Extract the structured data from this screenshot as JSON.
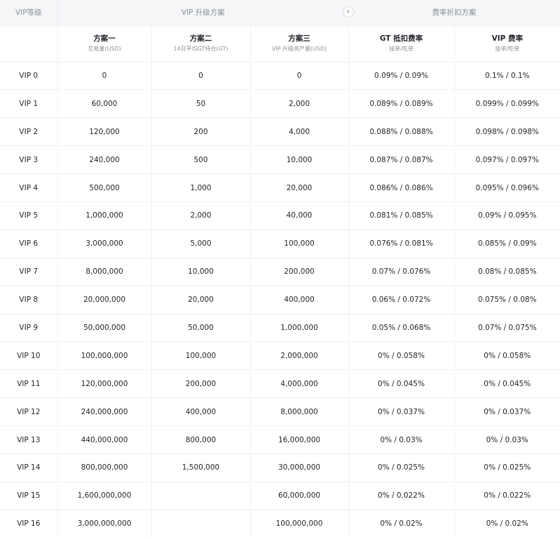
{
  "header": {
    "level_col": "VIP等级",
    "upgrade_group": "VIP 升级方案",
    "discount_group": "费率折扣方案"
  },
  "plans": [
    {
      "title": "方案一",
      "desc": "交易量(USD)"
    },
    {
      "title": "方案二",
      "desc": "14日平均GT持仓(GT)"
    },
    {
      "title": "方案三",
      "desc": "VIP 升级资产量(USD)"
    },
    {
      "title": "GT 抵扣费率",
      "desc": "挂单/吃单"
    },
    {
      "title": "VIP 费率",
      "desc": "挂单/吃单"
    }
  ],
  "icons": {
    "collapse": "chevron-left-icon"
  },
  "rows": [
    {
      "level": "VIP 0",
      "plan1": "0",
      "plan2": "0",
      "plan3": "0",
      "gt_rate": "0.09% / 0.09%",
      "vip_rate": "0.1% / 0.1%"
    },
    {
      "level": "VIP 1",
      "plan1": "60,000",
      "plan2": "50",
      "plan3": "2,000",
      "gt_rate": "0.089% / 0.089%",
      "vip_rate": "0.099% / 0.099%"
    },
    {
      "level": "VIP 2",
      "plan1": "120,000",
      "plan2": "200",
      "plan3": "4,000",
      "gt_rate": "0.088% / 0.088%",
      "vip_rate": "0.098% / 0.098%"
    },
    {
      "level": "VIP 3",
      "plan1": "240,000",
      "plan2": "500",
      "plan3": "10,000",
      "gt_rate": "0.087% / 0.087%",
      "vip_rate": "0.097% / 0.097%"
    },
    {
      "level": "VIP 4",
      "plan1": "500,000",
      "plan2": "1,000",
      "plan3": "20,000",
      "gt_rate": "0.086% / 0.086%",
      "vip_rate": "0.095% / 0.096%"
    },
    {
      "level": "VIP 5",
      "plan1": "1,000,000",
      "plan2": "2,000",
      "plan3": "40,000",
      "gt_rate": "0.081% / 0.085%",
      "vip_rate": "0.09% / 0.095%"
    },
    {
      "level": "VIP 6",
      "plan1": "3,000,000",
      "plan2": "5,000",
      "plan3": "100,000",
      "gt_rate": "0.076% / 0.081%",
      "vip_rate": "0.085% / 0.09%"
    },
    {
      "level": "VIP 7",
      "plan1": "8,000,000",
      "plan2": "10,000",
      "plan3": "200,000",
      "gt_rate": "0.07% / 0.076%",
      "vip_rate": "0.08% / 0.085%"
    },
    {
      "level": "VIP 8",
      "plan1": "20,000,000",
      "plan2": "20,000",
      "plan3": "400,000",
      "gt_rate": "0.06% / 0.072%",
      "vip_rate": "0.075% / 0.08%"
    },
    {
      "level": "VIP 9",
      "plan1": "50,000,000",
      "plan2": "50,000",
      "plan3": "1,000,000",
      "gt_rate": "0.05% / 0.068%",
      "vip_rate": "0.07% / 0.075%"
    },
    {
      "level": "VIP 10",
      "plan1": "100,000,000",
      "plan2": "100,000",
      "plan3": "2,000,000",
      "gt_rate": "0% / 0.058%",
      "vip_rate": "0% / 0.058%"
    },
    {
      "level": "VIP 11",
      "plan1": "120,000,000",
      "plan2": "200,000",
      "plan3": "4,000,000",
      "gt_rate": "0% / 0.045%",
      "vip_rate": "0% / 0.045%"
    },
    {
      "level": "VIP 12",
      "plan1": "240,000,000",
      "plan2": "400,000",
      "plan3": "8,000,000",
      "gt_rate": "0% / 0.037%",
      "vip_rate": "0% / 0.037%"
    },
    {
      "level": "VIP 13",
      "plan1": "440,000,000",
      "plan2": "800,000",
      "plan3": "16,000,000",
      "gt_rate": "0% / 0.03%",
      "vip_rate": "0% / 0.03%"
    },
    {
      "level": "VIP 14",
      "plan1": "800,000,000",
      "plan2": "1,500,000",
      "plan3": "30,000,000",
      "gt_rate": "0% / 0.025%",
      "vip_rate": "0% / 0.025%"
    },
    {
      "level": "VIP 15",
      "plan1": "1,600,000,000",
      "plan2": "",
      "plan3": "60,000,000",
      "gt_rate": "0% / 0.022%",
      "vip_rate": "0% / 0.022%"
    },
    {
      "level": "VIP 16",
      "plan1": "3,000,000,000",
      "plan2": "",
      "plan3": "100,000,000",
      "gt_rate": "0% / 0.02%",
      "vip_rate": "0% / 0.02%"
    }
  ]
}
